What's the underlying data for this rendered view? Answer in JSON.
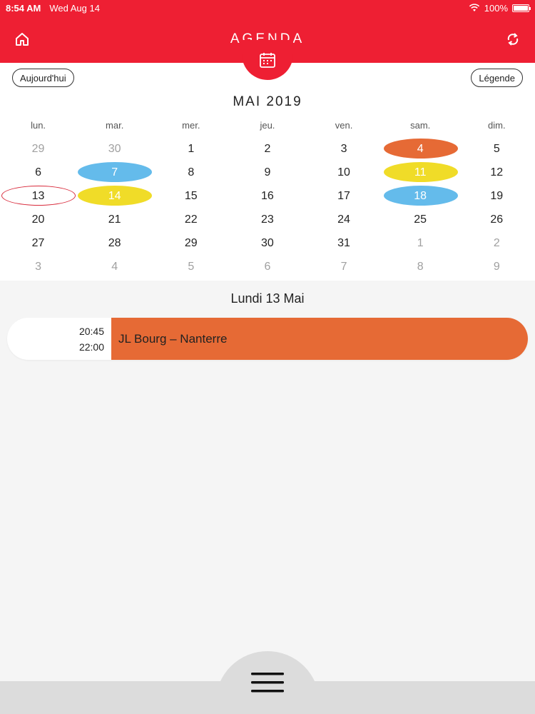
{
  "status_bar": {
    "time": "8:54 AM",
    "date": "Wed Aug 14",
    "battery": "100%"
  },
  "header": {
    "title": "AGENDA"
  },
  "buttons": {
    "today": "Aujourd'hui",
    "legend": "Légende"
  },
  "calendar": {
    "month_title": "MAI 2019",
    "weekdays": [
      "lun.",
      "mar.",
      "mer.",
      "jeu.",
      "ven.",
      "sam.",
      "dim."
    ],
    "weeks": [
      [
        {
          "d": "29",
          "m": true
        },
        {
          "d": "30",
          "m": true
        },
        {
          "d": "1"
        },
        {
          "d": "2"
        },
        {
          "d": "3"
        },
        {
          "d": "4",
          "c": "orange"
        },
        {
          "d": "5"
        }
      ],
      [
        {
          "d": "6"
        },
        {
          "d": "7",
          "c": "blue"
        },
        {
          "d": "8"
        },
        {
          "d": "9"
        },
        {
          "d": "10"
        },
        {
          "d": "11",
          "c": "yellow"
        },
        {
          "d": "12"
        }
      ],
      [
        {
          "d": "13",
          "c": "today"
        },
        {
          "d": "14",
          "c": "yellow"
        },
        {
          "d": "15"
        },
        {
          "d": "16"
        },
        {
          "d": "17"
        },
        {
          "d": "18",
          "c": "blue"
        },
        {
          "d": "19"
        }
      ],
      [
        {
          "d": "20"
        },
        {
          "d": "21"
        },
        {
          "d": "22"
        },
        {
          "d": "23"
        },
        {
          "d": "24"
        },
        {
          "d": "25"
        },
        {
          "d": "26"
        }
      ],
      [
        {
          "d": "27"
        },
        {
          "d": "28"
        },
        {
          "d": "29"
        },
        {
          "d": "30"
        },
        {
          "d": "31"
        },
        {
          "d": "1",
          "m": true
        },
        {
          "d": "2",
          "m": true
        }
      ],
      [
        {
          "d": "3",
          "m": true
        },
        {
          "d": "4",
          "m": true
        },
        {
          "d": "5",
          "m": true
        },
        {
          "d": "6",
          "m": true
        },
        {
          "d": "7",
          "m": true
        },
        {
          "d": "8",
          "m": true
        },
        {
          "d": "9",
          "m": true
        }
      ]
    ]
  },
  "selected": {
    "date_label": "Lundi 13 Mai"
  },
  "events": [
    {
      "start": "20:45",
      "end": "22:00",
      "title": "JL Bourg – Nanterre",
      "color": "#e66a35"
    }
  ],
  "colors": {
    "brand": "#ee1f33",
    "orange": "#e66a35",
    "blue": "#64bbeb",
    "yellow": "#f0dc28"
  },
  "icons": {
    "home": "home-icon",
    "refresh": "refresh-icon",
    "calendar": "calendar-icon",
    "menu": "hamburger-menu-icon",
    "wifi": "wifi-icon",
    "battery": "battery-icon"
  }
}
